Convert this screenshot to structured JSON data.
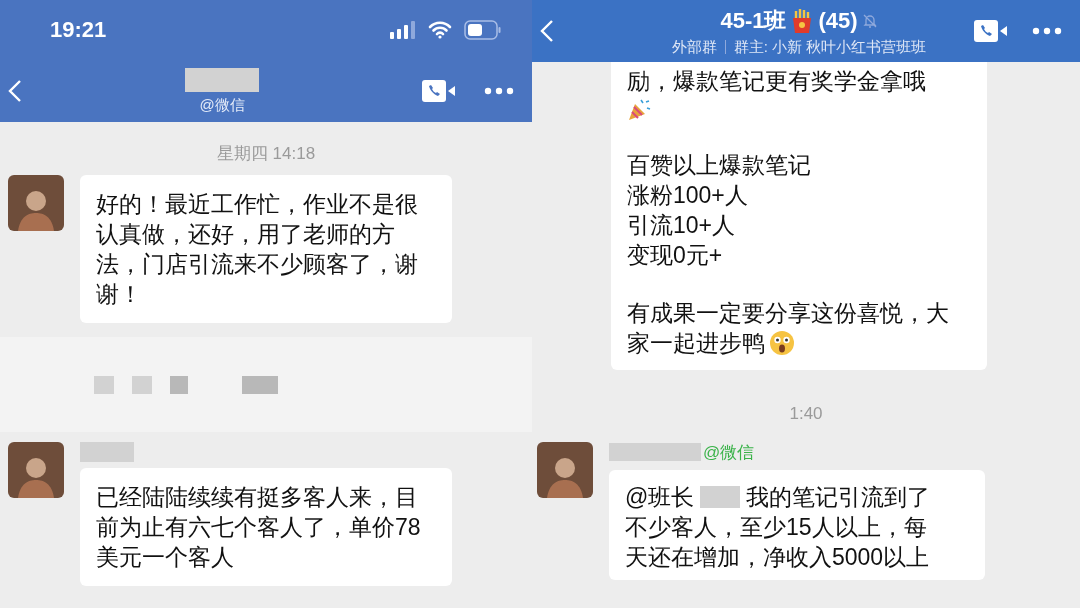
{
  "left": {
    "status_bar": {
      "time": "19:21"
    },
    "nav": {
      "subtitle": "@微信"
    },
    "timestamp": "星期四 14:18",
    "messages": [
      {
        "text": "好的！最近工作忙，作业不是很认真做，还好，用了老师的方法，门店引流来不少顾客了，谢谢！"
      },
      {
        "text": "已经陆陆续续有挺多客人来，目前为止有六七个客人了，单价78美元一个客人"
      }
    ]
  },
  "right": {
    "title": "45-1班",
    "count": "(45)",
    "tag": "外部群",
    "owner": "群主: 小新 秋叶小红书营班班",
    "notice": {
      "lead": "励，爆款笔记更有奖学金拿哦",
      "stats": [
        "百赞以上爆款笔记",
        "涨粉100+人",
        "引流10+人",
        "变现0元+"
      ],
      "closing": [
        "有成果一定要分享这份喜悦，大",
        "家一起进步鸭"
      ]
    },
    "timestamp": "1:40",
    "sender_suffix": "@微信",
    "mention": "@班长",
    "message": [
      "我的笔记引流到了",
      "不少客人，至少15人以上，每",
      "天还在增加，净收入5000以上"
    ]
  }
}
